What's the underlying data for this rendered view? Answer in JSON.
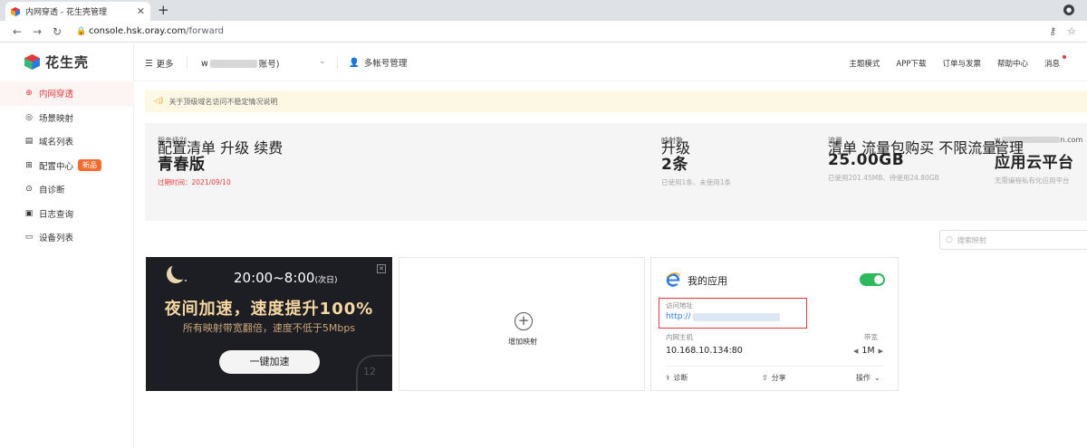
{
  "browser": {
    "tab_title": "内网穿透 - 花生壳管理",
    "new_tab": "+",
    "url_host": "console.hsk.oray.com",
    "url_path": "/forward"
  },
  "sidebar": {
    "logo_text": "花生壳",
    "items": [
      {
        "label": "内网穿透",
        "icon": "tunnel-icon"
      },
      {
        "label": "场景映射",
        "icon": "scene-icon"
      },
      {
        "label": "域名列表",
        "icon": "domain-list-icon"
      },
      {
        "label": "配置中心",
        "icon": "config-icon",
        "badge": "新品"
      },
      {
        "label": "自诊断",
        "icon": "diagnose-icon"
      },
      {
        "label": "日志查询",
        "icon": "log-icon"
      },
      {
        "label": "设备列表",
        "icon": "device-icon"
      }
    ]
  },
  "header": {
    "more": "更多",
    "account_prefix": "w",
    "account_suffix": "账号)",
    "multi_account": "多帐号管理",
    "nav": [
      "主题模式",
      "APP下载",
      "订单与发票",
      "帮助中心",
      "消息"
    ]
  },
  "notice": "关于顶级域名访问不稳定情况说明",
  "stats": {
    "service": {
      "label": "服务级别",
      "value": "青春版",
      "sub": "过期时间：2021/09/10",
      "links": [
        "配置清单",
        "升级",
        "续费"
      ]
    },
    "mappings": {
      "label": "映射数",
      "value": "2条",
      "sub": "已使用1条、未使用1条",
      "links": [
        "升级"
      ]
    },
    "traffic": {
      "label": "流量",
      "value": "25.00GB",
      "sub": "已使用201.45MB、待使用24.80GB",
      "links": [
        "清单",
        "流量包购买",
        "不限流量"
      ]
    },
    "cloud": {
      "label_prefix": "w",
      "label_suffix": "n.com",
      "value": "应用云平台",
      "sub": "无需编程私有化应用平台",
      "links": [
        "管理"
      ]
    }
  },
  "search_placeholder": "搜索映射",
  "promo": {
    "time": "20:00~8:00",
    "time_note": "(次日)",
    "headline": "夜间加速，速度提升100%",
    "desc": "所有映射带宽翻倍，速度不低于5Mbps",
    "cta": "一键加速",
    "dial_number": "12"
  },
  "add_card": {
    "label": "增加映射"
  },
  "app_card": {
    "title": "我的应用",
    "access_label": "访问地址",
    "access_url": "http://",
    "lan_label": "内网主机",
    "lan_value": "10.168.10.134:80",
    "bw_label": "带宽",
    "bw_value": "1M",
    "actions": [
      "诊断",
      "分享",
      "操作"
    ]
  },
  "colors": {
    "accent": "#e4393c",
    "toggle_on": "#2eb85c",
    "link": "#2a7ae2"
  }
}
